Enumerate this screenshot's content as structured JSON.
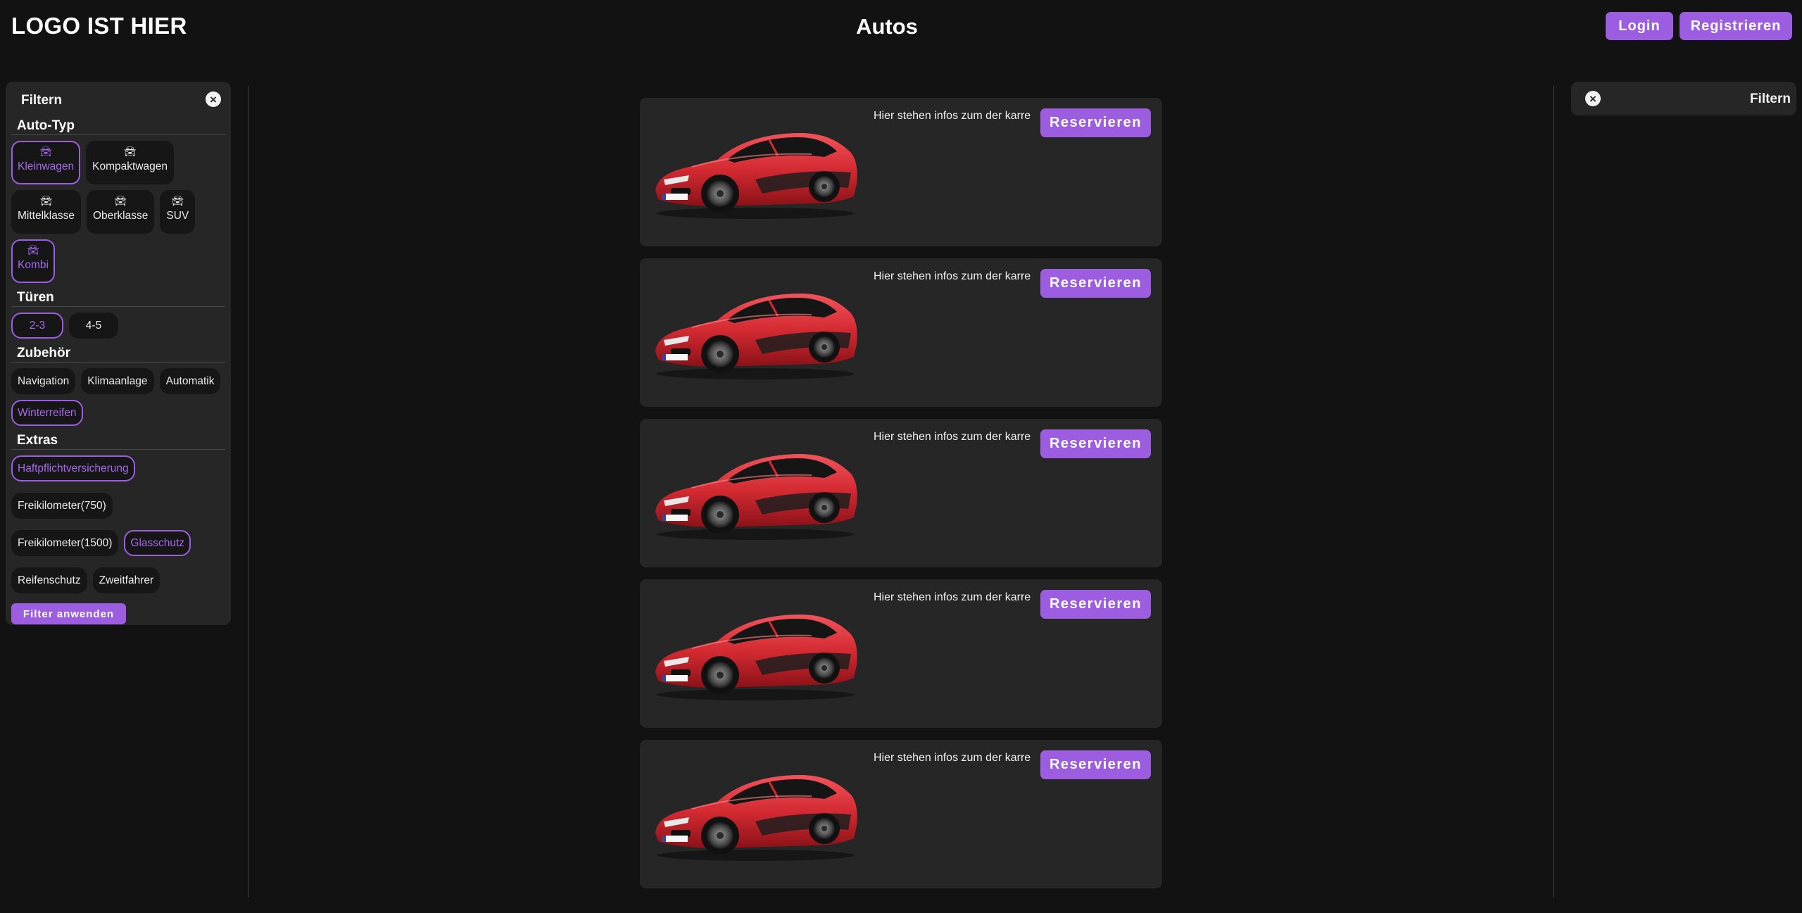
{
  "header": {
    "logo": "LOGO IST HIER",
    "title": "Autos",
    "login_label": "Login",
    "register_label": "Registrieren"
  },
  "filter_panel": {
    "title": "Filtern",
    "close_icon": "close-circle-icon",
    "sections": {
      "auto_typ": {
        "title": "Auto-Typ",
        "items": [
          {
            "label": "Kleinwagen",
            "icon": "car-icon",
            "selected": true
          },
          {
            "label": "Kompaktwagen",
            "icon": "car-icon",
            "selected": false
          },
          {
            "label": "Mittelklasse",
            "icon": "car-icon",
            "selected": false
          },
          {
            "label": "Oberklasse",
            "icon": "car-icon",
            "selected": false
          },
          {
            "label": "SUV",
            "icon": "car-icon",
            "selected": false
          },
          {
            "label": "Kombi",
            "icon": "car-icon",
            "selected": true
          }
        ]
      },
      "tueren": {
        "title": "Türen",
        "items": [
          {
            "label": "2-3",
            "selected": true
          },
          {
            "label": "4-5",
            "selected": false
          }
        ]
      },
      "zubehoer": {
        "title": "Zubehör",
        "items": [
          {
            "label": "Navigation",
            "selected": false
          },
          {
            "label": "Klimaanlage",
            "selected": false
          },
          {
            "label": "Automatik",
            "selected": false
          },
          {
            "label": "Winterreifen",
            "selected": true
          }
        ]
      },
      "extras": {
        "title": "Extras",
        "items": [
          {
            "label": "Haftpflichtversicherung",
            "selected": true
          },
          {
            "label": "Freikilometer(750)",
            "selected": false
          },
          {
            "label": "Freikilometer(1500)",
            "selected": false
          },
          {
            "label": "Glasschutz",
            "selected": true
          },
          {
            "label": "Reifenschutz",
            "selected": false
          },
          {
            "label": "Zweitfahrer",
            "selected": false
          }
        ]
      }
    },
    "apply_label": "Filter anwenden"
  },
  "listings": [
    {
      "info": "Hier stehen infos zum der karre",
      "reserve_label": "Reservieren"
    },
    {
      "info": "Hier stehen infos zum der karre",
      "reserve_label": "Reservieren"
    },
    {
      "info": "Hier stehen infos zum der karre",
      "reserve_label": "Reservieren"
    },
    {
      "info": "Hier stehen infos zum der karre",
      "reserve_label": "Reservieren"
    },
    {
      "info": "Hier stehen infos zum der karre",
      "reserve_label": "Reservieren"
    }
  ],
  "filter_collapsed": {
    "title": "Filtern",
    "close_icon": "close-circle-icon"
  },
  "colors": {
    "accent": "#9c5de0",
    "background": "#121212",
    "panel": "#262626",
    "chip": "#161616",
    "car_red": "#d42a32"
  }
}
